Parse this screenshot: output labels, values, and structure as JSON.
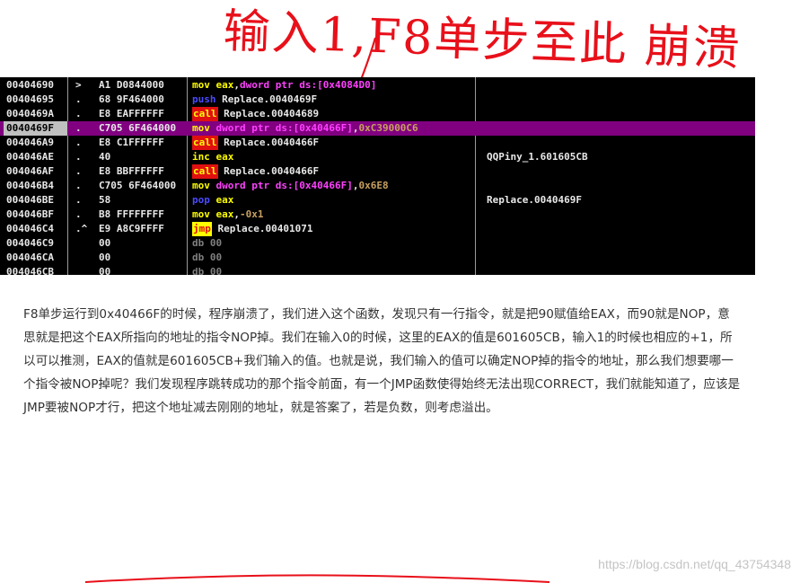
{
  "annotation": {
    "handwritten_note": "输入1,F8单步至此 崩溃",
    "color": "#e8101a"
  },
  "debugger": {
    "rows": [
      {
        "addr": "00404690",
        "mark": ">",
        "hex": "A1 D0844000",
        "asm": [
          {
            "t": "mov",
            "c": "t-mov"
          },
          {
            "t": " "
          },
          {
            "t": "eax",
            "c": "t-reg"
          },
          {
            "t": ","
          },
          {
            "t": "dword ptr ds:[0x4084D0]",
            "c": "t-mem"
          }
        ],
        "comment": ""
      },
      {
        "addr": "00404695",
        "mark": ".",
        "hex": "68 9F464000",
        "asm": [
          {
            "t": "push",
            "c": "t-push"
          },
          {
            "t": " Replace.0040469F"
          }
        ],
        "comment": ""
      },
      {
        "addr": "0040469A",
        "mark": ".",
        "hex": "E8 EAFFFFFF",
        "asm": [
          {
            "t": "call",
            "c": "t-call"
          },
          {
            "t": " Replace.00404689"
          }
        ],
        "comment": ""
      },
      {
        "addr": "0040469F",
        "mark": ".",
        "hex": "C705 6F464000",
        "asm": [
          {
            "t": "mov",
            "c": "t-mov"
          },
          {
            "t": " "
          },
          {
            "t": "dword ptr ds:[0x40466F]",
            "c": "t-mem"
          },
          {
            "t": ","
          },
          {
            "t": "0xC39000C6",
            "c": "t-imm"
          }
        ],
        "comment": "",
        "selected": true
      },
      {
        "addr": "004046A9",
        "mark": ".",
        "hex": "E8 C1FFFFFF",
        "asm": [
          {
            "t": "call",
            "c": "t-call"
          },
          {
            "t": " Replace.0040466F"
          }
        ],
        "comment": ""
      },
      {
        "addr": "004046AE",
        "mark": ".",
        "hex": "40",
        "asm": [
          {
            "t": "inc",
            "c": "t-inc"
          },
          {
            "t": " "
          },
          {
            "t": "eax",
            "c": "t-reg"
          }
        ],
        "comment": "QQPiny_1.601605CB"
      },
      {
        "addr": "004046AF",
        "mark": ".",
        "hex": "E8 BBFFFFFF",
        "asm": [
          {
            "t": "call",
            "c": "t-call"
          },
          {
            "t": " Replace.0040466F"
          }
        ],
        "comment": ""
      },
      {
        "addr": "004046B4",
        "mark": ".",
        "hex": "C705 6F464000",
        "asm": [
          {
            "t": "mov",
            "c": "t-mov"
          },
          {
            "t": " "
          },
          {
            "t": "dword ptr ds:[0x40466F]",
            "c": "t-mem"
          },
          {
            "t": ","
          },
          {
            "t": "0x6E8",
            "c": "t-imm"
          }
        ],
        "comment": ""
      },
      {
        "addr": "004046BE",
        "mark": ".",
        "hex": "58",
        "asm": [
          {
            "t": "pop",
            "c": "t-pop"
          },
          {
            "t": " "
          },
          {
            "t": "eax",
            "c": "t-reg"
          }
        ],
        "comment": "Replace.0040469F"
      },
      {
        "addr": "004046BF",
        "mark": ".",
        "hex": "B8 FFFFFFFF",
        "asm": [
          {
            "t": "mov",
            "c": "t-mov"
          },
          {
            "t": " "
          },
          {
            "t": "eax",
            "c": "t-reg"
          },
          {
            "t": ","
          },
          {
            "t": "-0x1",
            "c": "t-imm"
          }
        ],
        "comment": ""
      },
      {
        "addr": "004046C4",
        "mark": ".^",
        "hex": "E9 A8C9FFFF",
        "asm": [
          {
            "t": "jmp",
            "c": "t-jmp"
          },
          {
            "t": " Replace.00401071"
          }
        ],
        "comment": ""
      },
      {
        "addr": "004046C9",
        "mark": "",
        "hex": "00",
        "asm": [
          {
            "t": "db 00",
            "c": "t-db"
          }
        ],
        "comment": ""
      },
      {
        "addr": "004046CA",
        "mark": "",
        "hex": "00",
        "asm": [
          {
            "t": "db 00",
            "c": "t-db"
          }
        ],
        "comment": ""
      },
      {
        "addr": "004046CB",
        "mark": "",
        "hex": "00",
        "asm": [
          {
            "t": "db 00",
            "c": "t-db"
          }
        ],
        "comment": ""
      }
    ]
  },
  "article": {
    "paragraph": "F8单步运行到0x40466F的时候，程序崩溃了，我们进入这个函数，发现只有一行指令，就是把90赋值给EAX，而90就是NOP，意思就是把这个EAX所指向的地址的指令NOP掉。我们在输入0的时候，这里的EAX的值是601605CB，输入1的时候也相应的+1，所以可以推测，EAX的值就是601605CB+我们输入的值。也就是说，我们输入的值可以确定NOP掉的指令的地址，那么我们想要哪一个指令被NOP掉呢？我们发现程序跳转成功的那个指令前面，有一个JMP函数使得始终无法出现CORRECT，我们就能知道了，应该是JMP要被NOP才行，把这个地址减去刚刚的地址，就是答案了，若是负数，则考虑溢出。"
  },
  "watermark": "https://blog.csdn.net/qq_43754348"
}
